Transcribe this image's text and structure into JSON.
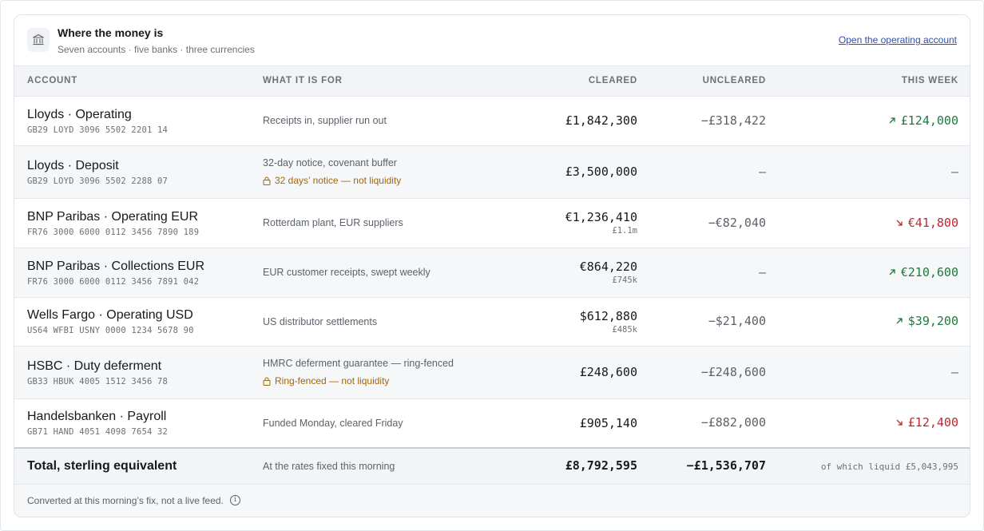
{
  "header": {
    "title": "Where the money is",
    "subtitle": "Seven accounts · five banks · three currencies",
    "link": "Open the operating account",
    "icon": "bank-icon"
  },
  "columns": {
    "account": "ACCOUNT",
    "purpose": "WHAT IT IS FOR",
    "cleared": "CLEARED",
    "uncleared": "UNCLEARED",
    "this_week": "THIS WEEK"
  },
  "colors": {
    "up": "#1e7a3c",
    "down": "#c0262d",
    "warning": "#a0670b",
    "link": "#2f4fa8"
  },
  "rows": [
    {
      "name": "Lloyds · Operating",
      "iban": "GB29 LOYD 3096 5502 2201 14",
      "purpose": "Receipts in, supplier run out",
      "cleared": "£1,842,300",
      "uncleared": "−£318,422",
      "week": "£124,000",
      "trend": "up"
    },
    {
      "name": "Lloyds · Deposit",
      "iban": "GB29 LOYD 3096 5502 2288 07",
      "purpose": "32-day notice, covenant buffer",
      "warning": "32 days’ notice — not liquidity",
      "cleared": "£3,500,000",
      "uncleared": "—",
      "week": "—",
      "trend": "none"
    },
    {
      "name": "BNP Paribas · Operating EUR",
      "iban": "FR76 3000 6000 0112 3456 7890 189",
      "purpose": "Rotterdam plant, EUR suppliers",
      "cleared": "€1,236,410",
      "cleared_gbp": "£1.1m",
      "uncleared": "−€82,040",
      "week": "€41,800",
      "trend": "down"
    },
    {
      "name": "BNP Paribas · Collections EUR",
      "iban": "FR76 3000 6000 0112 3456 7891 042",
      "purpose": "EUR customer receipts, swept weekly",
      "cleared": "€864,220",
      "cleared_gbp": "£745k",
      "uncleared": "—",
      "week": "€210,600",
      "trend": "up"
    },
    {
      "name": "Wells Fargo · Operating USD",
      "iban": "US64 WFBI USNY 0000 1234 5678 90",
      "purpose": "US distributor settlements",
      "cleared": "$612,880",
      "cleared_gbp": "£485k",
      "uncleared": "−$21,400",
      "week": "$39,200",
      "trend": "up"
    },
    {
      "name": "HSBC · Duty deferment",
      "iban": "GB33 HBUK 4005 1512 3456 78",
      "purpose": "HMRC deferment guarantee — ring-fenced",
      "warning": "Ring-fenced — not liquidity",
      "cleared": "£248,600",
      "uncleared": "−£248,600",
      "week": "—",
      "trend": "none"
    },
    {
      "name": "Handelsbanken · Payroll",
      "iban": "GB71 HAND 4051 4098 7654 32",
      "purpose": "Funded Monday, cleared Friday",
      "cleared": "£905,140",
      "uncleared": "−£882,000",
      "week": "£12,400",
      "trend": "down"
    }
  ],
  "total": {
    "label": "Total, sterling equivalent",
    "note": "At the rates fixed this morning",
    "cleared": "£8,792,595",
    "uncleared": "−£1,536,707",
    "liquid": "of which liquid £5,043,995"
  },
  "footer": {
    "text": "Converted at this morning’s fix, not a live feed.",
    "icon": "info-icon"
  }
}
